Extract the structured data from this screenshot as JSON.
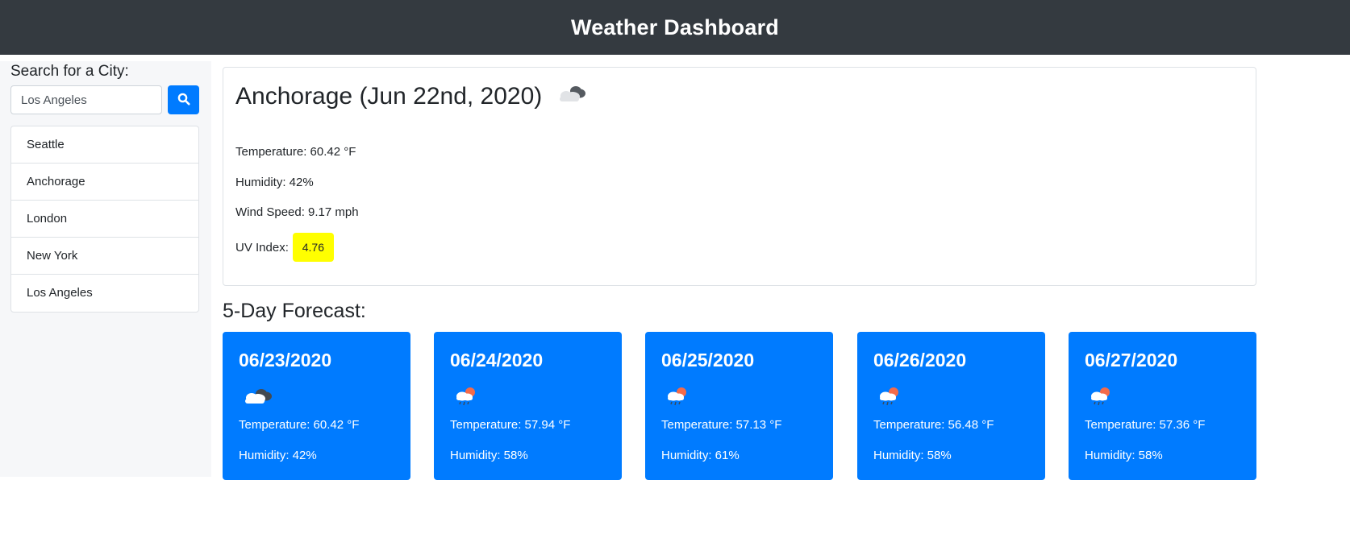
{
  "header": {
    "title": "Weather Dashboard"
  },
  "sidebar": {
    "search_label": "Search for a City:",
    "search_value": "Los Angeles",
    "search_button_icon": "search-icon",
    "cities": [
      "Seattle",
      "Anchorage",
      "London",
      "New York",
      "Los Angeles"
    ]
  },
  "current": {
    "title": "Anchorage (Jun 22nd, 2020)",
    "icon": "broken-clouds-icon",
    "temperature": "Temperature: 60.42 °F",
    "humidity": "Humidity: 42%",
    "wind": "Wind Speed: 9.17 mph",
    "uv_label": "UV Index:",
    "uv_value": "4.76",
    "uv_color": "#ffff00"
  },
  "forecast": {
    "heading": "5-Day Forecast:",
    "accent": "#007bff",
    "days": [
      {
        "date": "06/23/2020",
        "icon": "broken-clouds-icon",
        "temp": "Temperature: 60.42 °F",
        "humidity": "Humidity: 42%"
      },
      {
        "date": "06/24/2020",
        "icon": "rain-sun-icon",
        "temp": "Temperature: 57.94 °F",
        "humidity": "Humidity: 58%"
      },
      {
        "date": "06/25/2020",
        "icon": "rain-sun-icon",
        "temp": "Temperature: 57.13 °F",
        "humidity": "Humidity: 61%"
      },
      {
        "date": "06/26/2020",
        "icon": "rain-sun-icon",
        "temp": "Temperature: 56.48 °F",
        "humidity": "Humidity: 58%"
      },
      {
        "date": "06/27/2020",
        "icon": "rain-sun-icon",
        "temp": "Temperature: 57.36 °F",
        "humidity": "Humidity: 58%"
      }
    ]
  }
}
